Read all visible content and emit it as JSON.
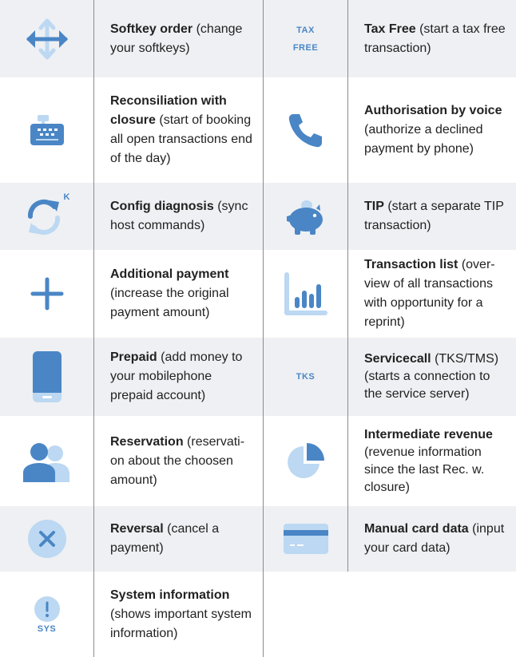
{
  "colors": {
    "accent": "#4a86c5",
    "light_blue": "#bcd8f2",
    "row_shade": "#eef0f3",
    "divider": "#8c8c8c"
  },
  "rows": [
    {
      "left": {
        "icon": "arrows-move-icon",
        "title": "Softkey order",
        "desc": " (change your softkeys)"
      },
      "right": {
        "icon": "tax-free-icon",
        "icon_text": [
          "TAX",
          "FREE"
        ],
        "title": "Tax Free",
        "desc": " (start a tax free transaction)"
      }
    },
    {
      "left": {
        "icon": "cash-register-icon",
        "title": "Reconsiliation with closure",
        "desc": " (start of booking all open transactions end of the day)"
      },
      "right": {
        "icon": "phone-icon",
        "title": "Authorisation by voice",
        "desc": " (authorize a declined payment by phone)"
      }
    },
    {
      "left": {
        "icon": "sync-icon",
        "icon_text": "K",
        "title": "Config diagnosis",
        "desc": " (sync host commands)"
      },
      "right": {
        "icon": "piggy-bank-icon",
        "title": "TIP",
        "desc": " (start a separate TIP transaction)"
      }
    },
    {
      "left": {
        "icon": "plus-icon",
        "title": "Additional payment",
        "desc": " (increase the original payment amount)"
      },
      "right": {
        "icon": "bar-chart-icon",
        "title": "Transaction list",
        "desc": " (over-view of all transactions with opportunity for a reprint)"
      }
    },
    {
      "left": {
        "icon": "mobile-phone-icon",
        "title": "Prepaid",
        "desc": " (add money to your mobilephone prepaid account)"
      },
      "right": {
        "icon": "tks-icon",
        "icon_text": "TKS",
        "title": "Servicecall",
        "desc": " (TKS/TMS) (starts a connection to the service server)"
      }
    },
    {
      "left": {
        "icon": "users-icon",
        "title": "Reservation",
        "desc": " (reservati-on about the choosen amount)"
      },
      "right": {
        "icon": "pie-chart-icon",
        "title": "Intermediate revenue",
        "desc": " (revenue information since the last Rec. w. closure)"
      }
    },
    {
      "left": {
        "icon": "cancel-icon",
        "title": "Reversal",
        "desc": " (cancel a payment)"
      },
      "right": {
        "icon": "credit-card-icon",
        "title": "Manual card data",
        "desc": " (input your card data)"
      }
    },
    {
      "left": {
        "icon": "system-info-icon",
        "icon_text": "SYS",
        "title": "System information",
        "desc": " (shows important system information)"
      },
      "right": null
    }
  ]
}
